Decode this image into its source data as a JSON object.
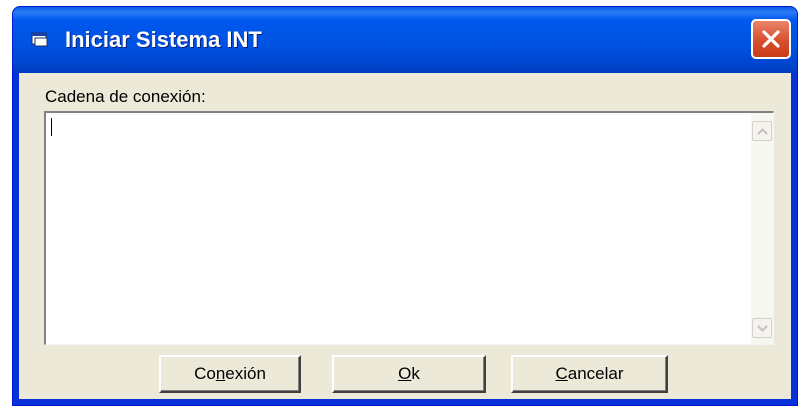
{
  "window": {
    "title": "Iniciar Sistema INT",
    "close_label": "Close"
  },
  "form": {
    "connection_label": "Cadena de conexión:",
    "connection_value": ""
  },
  "buttons": {
    "conexion": {
      "pre": "Co",
      "accel": "n",
      "post": "exión"
    },
    "ok": {
      "pre": "",
      "accel": "O",
      "post": "k"
    },
    "cancelar": {
      "pre": "",
      "accel": "C",
      "post": "ancelar"
    }
  },
  "icons": {
    "title": "window-app-icon",
    "close": "close-icon",
    "scroll_up": "chevron-up-icon",
    "scroll_down": "chevron-down-icon"
  },
  "colors": {
    "titlebar": "#0054e3",
    "close": "#d8502e",
    "dialog_bg": "#ece9d8"
  }
}
